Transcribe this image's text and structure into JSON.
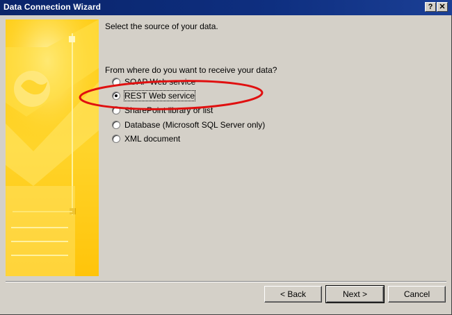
{
  "window": {
    "title": "Data Connection Wizard",
    "help_label": "?",
    "close_label": "✕"
  },
  "main": {
    "heading": "Select the source of your data.",
    "question": "From where do you want to receive your data?",
    "options": [
      {
        "label": "SOAP Web service",
        "selected": false
      },
      {
        "label": "REST Web service",
        "selected": true
      },
      {
        "label": "SharePoint library or list",
        "selected": false
      },
      {
        "label": "Database (Microsoft SQL Server only)",
        "selected": false
      },
      {
        "label": "XML document",
        "selected": false
      }
    ]
  },
  "footer": {
    "back_label": "< Back",
    "next_label": "Next >",
    "cancel_label": "Cancel"
  },
  "colors": {
    "titlebar": "#0a246a",
    "dialog_face": "#d4d0c8",
    "art_yellow": "#ffd21f",
    "annotation_red": "#e01010"
  }
}
